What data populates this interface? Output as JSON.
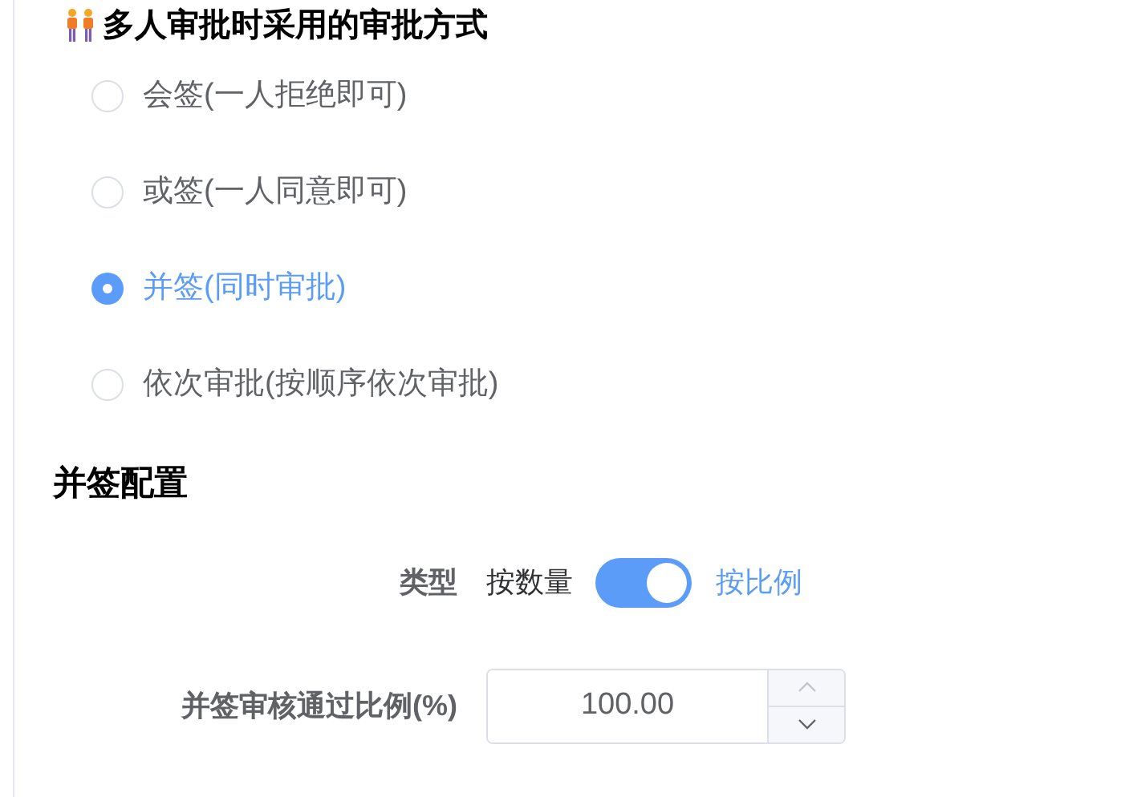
{
  "title": "多人审批时采用的审批方式",
  "options": [
    {
      "label": "会签(一人拒绝即可)",
      "selected": false
    },
    {
      "label": "或签(一人同意即可)",
      "selected": false
    },
    {
      "label": "并签(同时审批)",
      "selected": true
    },
    {
      "label": "依次审批(按顺序依次审批)",
      "selected": false
    }
  ],
  "config": {
    "heading": "并签配置",
    "type": {
      "label": "类型",
      "off_label": "按数量",
      "on_label": "按比例",
      "on": true
    },
    "ratio": {
      "label": "并签审核通过比例(%)",
      "value": "100.00",
      "increase_disabled": true
    }
  }
}
